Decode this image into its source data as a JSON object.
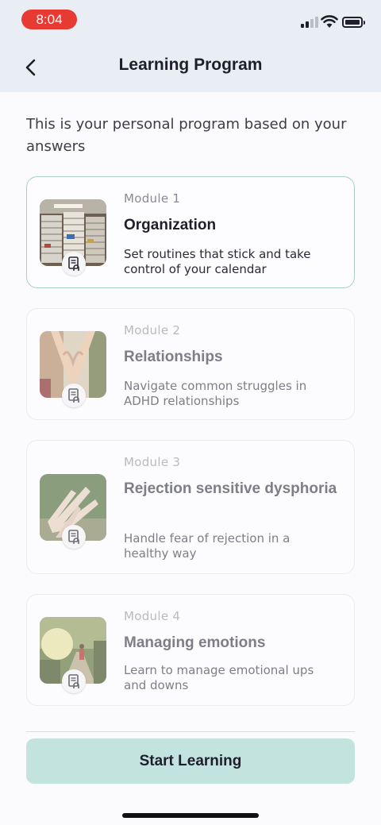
{
  "status_bar": {
    "time": "8:04"
  },
  "header": {
    "title": "Learning Program",
    "back_icon": "chevron-left-icon"
  },
  "intro": "This is your personal program based on your answers",
  "modules": [
    {
      "label": "Module 1",
      "title": "Organization",
      "description": "Set routines that stick and take control of your calendar",
      "state": "active"
    },
    {
      "label": "Module 2",
      "title": "Relationships",
      "description": "Navigate common struggles in ADHD relationships",
      "state": "locked"
    },
    {
      "label": "Module 3",
      "title": "Rejection sensitive dysphoria",
      "description": "Handle fear of rejection in a healthy way",
      "state": "locked"
    },
    {
      "label": "Module 4",
      "title": "Managing emotions",
      "description": "Learn to manage emotional ups and downs",
      "state": "locked"
    }
  ],
  "cta": {
    "label": "Start Learning"
  },
  "colors": {
    "accent": "#c3e4de",
    "active_border": "#a9cfc9",
    "status_red": "#e63a33"
  }
}
